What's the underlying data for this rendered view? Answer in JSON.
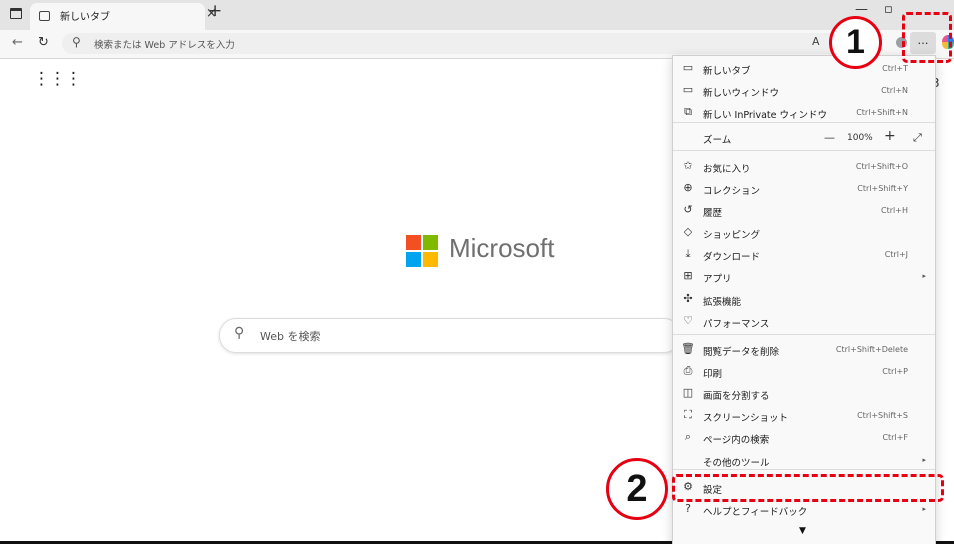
{
  "tab": {
    "title": "新しいタブ"
  },
  "address": {
    "placeholder": "検索または Web アドレスを入力",
    "readaloud": "A"
  },
  "toolbar": {
    "menu_label": "…"
  },
  "page": {
    "brand": "Microsoft",
    "search_placeholder": "Web を検索",
    "logo_colors": [
      "#f25022",
      "#7fba00",
      "#00a4ef",
      "#ffb900"
    ]
  },
  "menu": {
    "items": [
      {
        "icon": "new-tab-icon",
        "label": "新しいタブ",
        "shortcut": "Ctrl+T"
      },
      {
        "icon": "new-window-icon",
        "label": "新しいウィンドウ",
        "shortcut": "Ctrl+N"
      },
      {
        "icon": "inprivate-icon",
        "label": "新しい InPrivate ウィンドウ",
        "shortcut": "Ctrl+Shift+N"
      },
      {
        "label": "ズーム",
        "zoom_value": "100%"
      },
      {
        "icon": "favorites-icon",
        "label": "お気に入り",
        "shortcut": "Ctrl+Shift+O"
      },
      {
        "icon": "collections-icon",
        "label": "コレクション",
        "shortcut": "Ctrl+Shift+Y"
      },
      {
        "icon": "history-icon",
        "label": "履歴",
        "shortcut": "Ctrl+H"
      },
      {
        "icon": "shopping-icon",
        "label": "ショッピング",
        "shortcut": ""
      },
      {
        "icon": "download-icon",
        "label": "ダウンロード",
        "shortcut": "Ctrl+J"
      },
      {
        "icon": "apps-icon",
        "label": "アプリ",
        "submenu": true
      },
      {
        "icon": "extensions-icon",
        "label": "拡張機能",
        "shortcut": ""
      },
      {
        "icon": "performance-icon",
        "label": "パフォーマンス",
        "shortcut": ""
      },
      {
        "icon": "trash-icon",
        "label": "閲覧データを削除",
        "shortcut": "Ctrl+Shift+Delete"
      },
      {
        "icon": "print-icon",
        "label": "印刷",
        "shortcut": "Ctrl+P"
      },
      {
        "icon": "split-screen-icon",
        "label": "画面を分割する",
        "shortcut": ""
      },
      {
        "icon": "screenshot-icon",
        "label": "スクリーンショット",
        "shortcut": "Ctrl+Shift+S"
      },
      {
        "icon": "find-icon",
        "label": "ページ内の検索",
        "shortcut": "Ctrl+F"
      },
      {
        "label": "その他のツール",
        "submenu": true
      },
      {
        "icon": "gear-icon",
        "label": "設定",
        "shortcut": ""
      },
      {
        "icon": "help-icon",
        "label": "ヘルプとフィードバック",
        "submenu": true
      }
    ]
  },
  "annotations": {
    "step1": "1",
    "step2": "2",
    "color": "#e60012"
  }
}
